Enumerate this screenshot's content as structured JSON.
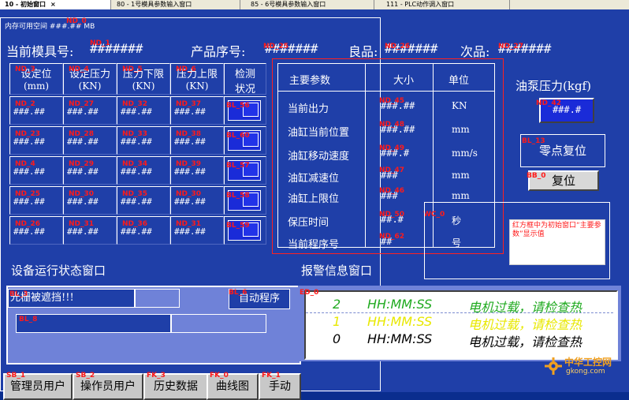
{
  "tabs": [
    {
      "label": "10 - 初始窗口",
      "close": "×"
    },
    {
      "label": "80 - 1号模具参数输入窗口"
    },
    {
      "label": "85 - 6号模具参数输入窗口"
    },
    {
      "label": "111 - PLC动作调入窗口"
    }
  ],
  "memory": {
    "label": "内存可用空间",
    "value": "###.## MB",
    "tag": "ND_0"
  },
  "header": {
    "mold_label": "当前模具号:",
    "mold_value": "#######",
    "mold_tag": "ND_1",
    "serial_label": "产品序号:",
    "serial_value": "#######",
    "serial_tag": "ND_25",
    "good_label": "良品:",
    "good_value": "#######",
    "good_tag": "ND_26",
    "bad_label": "次品:",
    "bad_value": "#######",
    "bad_tag": "ND_27"
  },
  "table": {
    "headers": [
      {
        "l1": "设定位",
        "l2": "(mm)",
        "tag": "ND_3"
      },
      {
        "l1": "设定压力",
        "l2": "(KN)",
        "tag": "ND_4"
      },
      {
        "l1": "压力下限",
        "l2": "(KN)",
        "tag": "ND_5"
      },
      {
        "l1": "压力上限",
        "l2": "(KN)",
        "tag": "ND_6"
      },
      {
        "l1": "检测",
        "l2": "状况"
      }
    ],
    "rows": [
      {
        "cells": [
          {
            "tag": "ND_2",
            "val": "###.##"
          },
          {
            "tag": "ND_27",
            "val": "###.##"
          },
          {
            "tag": "ND_32",
            "val": "###.##"
          },
          {
            "tag": "ND_37",
            "val": "###.##"
          }
        ],
        "ind": "BL_56"
      },
      {
        "cells": [
          {
            "tag": "ND_23",
            "val": "###.##"
          },
          {
            "tag": "ND_28",
            "val": "###.##"
          },
          {
            "tag": "ND_33",
            "val": "###.##"
          },
          {
            "tag": "ND_38",
            "val": "###.##"
          }
        ],
        "ind": "BL_60"
      },
      {
        "cells": [
          {
            "tag": "ND_4",
            "val": "###.##"
          },
          {
            "tag": "ND_29",
            "val": "###.##"
          },
          {
            "tag": "ND_34",
            "val": "###.##"
          },
          {
            "tag": "ND_39",
            "val": "###.##"
          }
        ],
        "ind": "BL_57"
      },
      {
        "cells": [
          {
            "tag": "ND_25",
            "val": "###.##"
          },
          {
            "tag": "ND_30",
            "val": "###.##"
          },
          {
            "tag": "ND_35",
            "val": "###.##"
          },
          {
            "tag": "ND_30",
            "val": "###.##"
          }
        ],
        "ind": "BL_58"
      },
      {
        "cells": [
          {
            "tag": "ND_26",
            "val": "###.##"
          },
          {
            "tag": "ND_31",
            "val": "###.##"
          },
          {
            "tag": "ND_36",
            "val": "###.##"
          },
          {
            "tag": "ND_31",
            "val": "###.##"
          }
        ],
        "ind": "BL_59"
      }
    ]
  },
  "params": {
    "headers": [
      "主要参数",
      "大小",
      "单位"
    ],
    "rows": [
      {
        "name": "当前出力",
        "tag": "ND_45",
        "val": "###.##",
        "unit": "KN"
      },
      {
        "name": "油缸当前位置",
        "tag": "ND_48",
        "val": "###.##",
        "unit": "mm"
      },
      {
        "name": "油缸移动速度",
        "tag": "ND_49",
        "val": "###.#",
        "unit": "mm/s"
      },
      {
        "name": "油缸减速位",
        "tag": "ND_47",
        "val": "###",
        "unit": "mm"
      },
      {
        "name": "油缸上限位",
        "tag": "ND_46",
        "val": "###",
        "unit": "mm"
      },
      {
        "name": "保压时间",
        "tag": "ND_50",
        "val": "##.#",
        "unit": "秒",
        "extra": "WC_0"
      },
      {
        "name": "当前程序号",
        "tag": "ND_62",
        "val": "##",
        "unit": "号"
      }
    ]
  },
  "pump": {
    "label": "油泵压力(kgf)",
    "tag": "ND_42",
    "value": "###.#"
  },
  "zero_reset": {
    "tag": "BL_13",
    "label": "零点复位"
  },
  "reset": {
    "tag": "BB_0",
    "label": "复位"
  },
  "note": "红方框中为初始窗口“主要参数”显示值",
  "status_title": "设备运行状态窗口",
  "alarm_title": "报警信息窗口",
  "status": {
    "line1_tag": "BL_3",
    "line1_text": "光栅被遮挡!!!",
    "auto_tag": "BL_6",
    "auto_label": "自动程序",
    "bar_tag": "BL_8"
  },
  "alarms": {
    "tag": "ED_0",
    "rows": [
      {
        "num": "2",
        "time": "HH:MM:SS",
        "msg": "电机过载，请检查热",
        "color": "#1faa1f"
      },
      {
        "num": "1",
        "time": "HH:MM:SS",
        "msg": "电机过载，请检查热",
        "color": "#e8e800"
      },
      {
        "num": "0",
        "time": "HH:MM:SS",
        "msg": "电机过载，请检查热",
        "color": "#000000"
      }
    ]
  },
  "fkeys": [
    {
      "tag": "SB_1",
      "label": "管理员用户"
    },
    {
      "tag": "SB_2",
      "label": "操作员用户"
    },
    {
      "tag": "FK_3",
      "label": "历史数据"
    },
    {
      "tag": "FK_0",
      "label": "曲线图"
    },
    {
      "tag": "FK_1",
      "label": "手动"
    }
  ],
  "watermark": {
    "cn": "中华工控网",
    "url": "gkong.com"
  }
}
